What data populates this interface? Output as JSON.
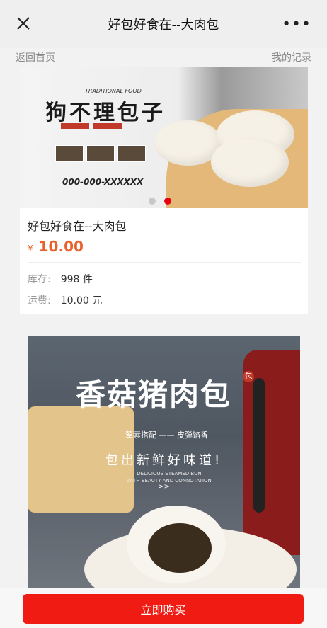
{
  "titlebar": {
    "title": "好包好食在--大肉包",
    "more_label": "•••"
  },
  "subnav": {
    "home_link": "返回首页",
    "records_link": "我的记录"
  },
  "banner": {
    "en_subtitle": "TRADITIONAL FOOD",
    "cn_title": "狗不理包子",
    "phone": "000-000-XXXXXX",
    "slide_count": 2,
    "active_slide": 2
  },
  "product": {
    "name": "好包好食在--大肉包",
    "currency_symbol": "¥",
    "price": "10.00",
    "stock_label": "库存:",
    "stock_value": "998  件",
    "shipping_label": "运费:",
    "shipping_value": "10.00  元"
  },
  "poster": {
    "title": "香菇猪肉包",
    "tag": "包",
    "line1": "荤素搭配 —— 皮弹馅香",
    "line2": "包出新鲜好味道!",
    "line3a": "DELICIOUS STEAMED BUN",
    "line3b": "WITH BEAUTY AND CONNOTATION",
    "arrow": ">>"
  },
  "footer": {
    "buy_label": "立即购买"
  },
  "colors": {
    "accent": "#e8612b",
    "buy_button": "#f01c14",
    "active_dot": "#e60012"
  }
}
